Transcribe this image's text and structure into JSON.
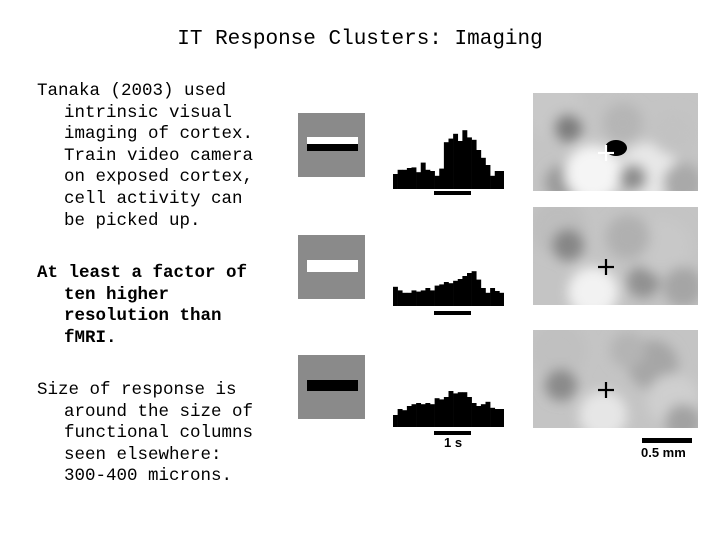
{
  "slide": {
    "title": "IT Response Clusters: Imaging",
    "paragraphs": [
      {
        "bold": false,
        "lines": [
          "Tanaka (2003) used",
          "intrinsic visual",
          "imaging of cortex.",
          "Train video camera",
          "on exposed cortex,",
          "cell activity can",
          "be picked up."
        ]
      },
      {
        "bold": true,
        "lines": [
          "At least a factor of",
          "ten higher",
          "resolution than",
          "fMRI."
        ]
      },
      {
        "bold": false,
        "lines": [
          "Size of response is",
          "around the size of",
          "functional columns",
          "seen elsewhere:",
          "300-400 microns."
        ]
      }
    ]
  },
  "figure": {
    "stimuli": [
      {
        "name": "white-over-black-bar",
        "parts": [
          "#ffffff",
          "#000000"
        ]
      },
      {
        "name": "white-bar",
        "parts": [
          "#ffffff"
        ]
      },
      {
        "name": "black-bar",
        "parts": [
          "#000000"
        ]
      }
    ],
    "histograms": [
      {
        "bins": [
          0.25,
          0.32,
          0.32,
          0.35,
          0.36,
          0.28,
          0.44,
          0.32,
          0.3,
          0.22,
          0.34,
          0.78,
          0.84,
          0.92,
          0.8,
          0.98,
          0.86,
          0.82,
          0.65,
          0.52,
          0.4,
          0.22,
          0.3,
          0.3
        ]
      },
      {
        "bins": [
          0.32,
          0.26,
          0.22,
          0.22,
          0.26,
          0.24,
          0.26,
          0.3,
          0.26,
          0.34,
          0.36,
          0.4,
          0.38,
          0.42,
          0.45,
          0.5,
          0.55,
          0.58,
          0.44,
          0.3,
          0.22,
          0.3,
          0.25,
          0.22
        ]
      },
      {
        "bins": [
          0.2,
          0.3,
          0.28,
          0.35,
          0.38,
          0.4,
          0.38,
          0.4,
          0.38,
          0.48,
          0.46,
          0.5,
          0.6,
          0.56,
          0.58,
          0.58,
          0.5,
          0.4,
          0.35,
          0.38,
          0.42,
          0.32,
          0.3,
          0.3
        ]
      }
    ],
    "time_scale_label": "1 s",
    "spatial_scale_label": "0.5 mm",
    "images": [
      {
        "cross_color": "#ffffff",
        "dark_spot": true
      },
      {
        "cross_color": "#000000",
        "dark_spot": false
      },
      {
        "cross_color": "#000000",
        "dark_spot": false
      }
    ]
  }
}
